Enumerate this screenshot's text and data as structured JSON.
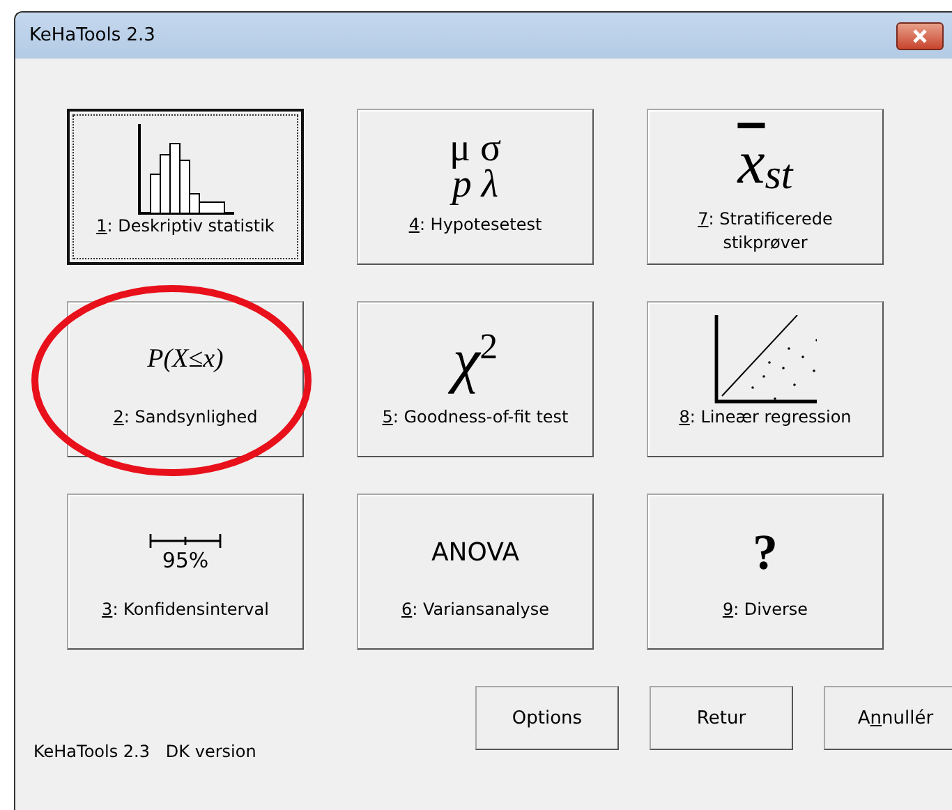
{
  "window": {
    "title": "KeHaTools 2.3"
  },
  "tiles": [
    {
      "kind": "histogram",
      "key": "1",
      "text": ": Deskriptiv statistik",
      "focused": true,
      "circled": false
    },
    {
      "kind": "prob",
      "key": "2",
      "text": ": Sandsynlighed",
      "symbol": "P(X≤x)",
      "focused": false,
      "circled": true
    },
    {
      "kind": "ci",
      "key": "3",
      "text": ": Konfidensinterval",
      "symbol": "95%",
      "focused": false,
      "circled": false
    },
    {
      "kind": "params",
      "key": "4",
      "text": ": Hypotesetest",
      "symbol_lines": [
        "μ σ",
        "p λ"
      ],
      "focused": false,
      "circled": false
    },
    {
      "kind": "chisq",
      "key": "5",
      "text": ": Goodness-of-fit test",
      "symbol": "χ",
      "superscript": "2",
      "focused": false,
      "circled": false
    },
    {
      "kind": "anova",
      "key": "6",
      "text": ": Variansanalyse",
      "symbol": "ANOVA",
      "focused": false,
      "circled": false
    },
    {
      "kind": "xbar",
      "key": "7",
      "text": ": Stratificerede stikprøver",
      "symbol": "x",
      "subscript": "st",
      "focused": false,
      "circled": false
    },
    {
      "kind": "scatter",
      "key": "8",
      "text": ": Lineær regression",
      "focused": false,
      "circled": false
    },
    {
      "kind": "question",
      "key": "9",
      "text": ": Diverse",
      "symbol": "?",
      "focused": false,
      "circled": false
    }
  ],
  "buttons": [
    {
      "parts": [
        {
          "text": "Options",
          "underline": false
        }
      ]
    },
    {
      "parts": [
        {
          "text": "Retur",
          "underline": false
        }
      ]
    },
    {
      "parts": [
        {
          "text": "A",
          "underline": false
        },
        {
          "text": "n",
          "underline": true
        },
        {
          "text": "nullér",
          "underline": false
        }
      ]
    }
  ],
  "status": "KeHaTools 2.3   DK version"
}
